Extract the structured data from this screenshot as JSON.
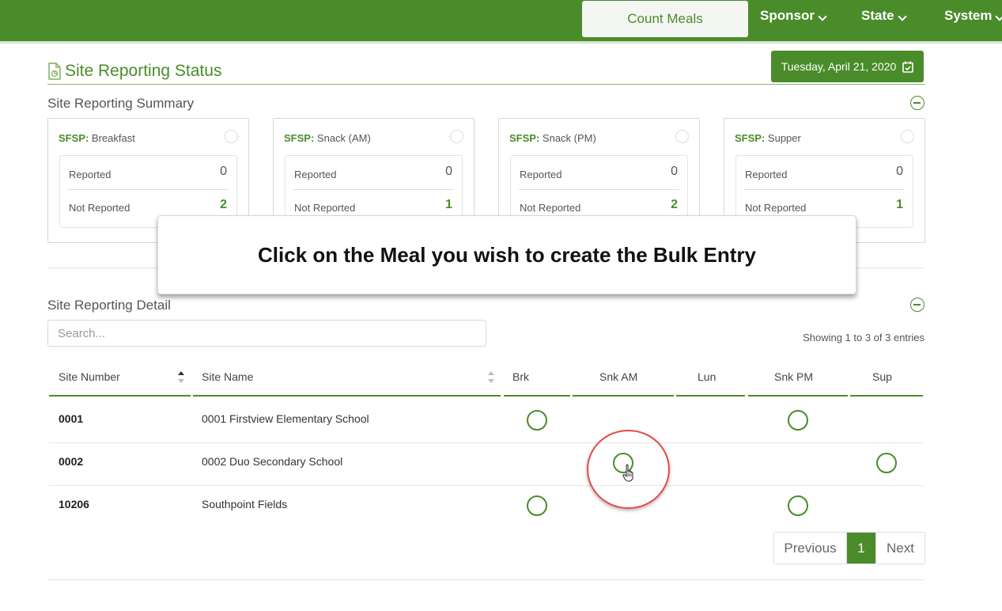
{
  "topnav": {
    "count_meals": "Count Meals",
    "items": [
      "Sponsor",
      "State",
      "System"
    ]
  },
  "page": {
    "title": "Site Reporting Status",
    "date": "Tuesday, April 21, 2020"
  },
  "summary": {
    "title": "Site Reporting Summary",
    "cards": [
      {
        "program": "SFSP:",
        "meal": "Breakfast",
        "reported_label": "Reported",
        "reported": "0",
        "not_reported_label": "Not Reported",
        "not_reported": "2"
      },
      {
        "program": "SFSP:",
        "meal": "Snack (AM)",
        "reported_label": "Reported",
        "reported": "0",
        "not_reported_label": "Not Reported",
        "not_reported": "1"
      },
      {
        "program": "SFSP:",
        "meal": "Snack (PM)",
        "reported_label": "Reported",
        "reported": "0",
        "not_reported_label": "Not Reported",
        "not_reported": "2"
      },
      {
        "program": "SFSP:",
        "meal": "Supper",
        "reported_label": "Reported",
        "reported": "0",
        "not_reported_label": "Not Reported",
        "not_reported": "1"
      }
    ]
  },
  "callout": "Click on the Meal you wish to create the Bulk Entry",
  "detail": {
    "title": "Site Reporting Detail",
    "search_placeholder": "Search...",
    "showing": "Showing 1 to 3 of 3 entries",
    "columns": [
      "Site Number",
      "Site Name",
      "Brk",
      "Snk AM",
      "Lun",
      "Snk PM",
      "Sup"
    ],
    "rows": [
      {
        "site_number": "0001",
        "site_name": "0001 Firstview Elementary School",
        "meals": [
          true,
          false,
          false,
          true,
          false
        ]
      },
      {
        "site_number": "0002",
        "site_name": "0002 Duo Secondary School",
        "meals": [
          false,
          true,
          false,
          false,
          true
        ]
      },
      {
        "site_number": "10206",
        "site_name": "Southpoint Fields",
        "meals": [
          true,
          false,
          false,
          true,
          false
        ]
      }
    ],
    "pagination": {
      "previous": "Previous",
      "current": "1",
      "next": "Next"
    }
  },
  "colors": {
    "brand_green": "#4a8c2a",
    "highlight_red": "#e44a4a"
  }
}
